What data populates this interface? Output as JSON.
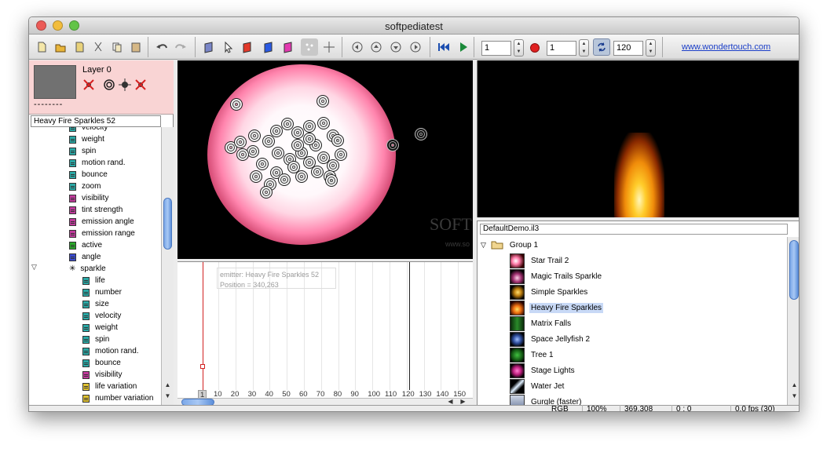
{
  "window": {
    "title": "softpediatest"
  },
  "toolbar": {
    "frame_value": "1",
    "record_value": "1",
    "fps_value": "120",
    "link_text": "www.wondertouch.com"
  },
  "layer": {
    "name": "Layer 0",
    "dashes": "--------"
  },
  "tree": {
    "header": "Heavy Fire Sparkles 52",
    "items": [
      {
        "label": "velocity",
        "color": "#2aa9a6"
      },
      {
        "label": "weight",
        "color": "#2aa9a6"
      },
      {
        "label": "spin",
        "color": "#2aa9a6"
      },
      {
        "label": "motion rand.",
        "color": "#2aa9a6"
      },
      {
        "label": "bounce",
        "color": "#2aa9a6"
      },
      {
        "label": "zoom",
        "color": "#2aa9a6"
      },
      {
        "label": "visibility",
        "color": "#c13a9c"
      },
      {
        "label": "tint strength",
        "color": "#c13a9c"
      },
      {
        "label": "emission angle",
        "color": "#c13a9c"
      },
      {
        "label": "emission range",
        "color": "#c13a9c"
      },
      {
        "label": "active",
        "color": "#2aaa2a"
      },
      {
        "label": "angle",
        "color": "#3a4acf"
      }
    ],
    "sparkle_label": "sparkle",
    "sparkle_items": [
      {
        "label": "life",
        "color": "#2aa9a6"
      },
      {
        "label": "number",
        "color": "#2aa9a6"
      },
      {
        "label": "size",
        "color": "#2aa9a6"
      },
      {
        "label": "velocity",
        "color": "#2aa9a6"
      },
      {
        "label": "weight",
        "color": "#2aa9a6"
      },
      {
        "label": "spin",
        "color": "#2aa9a6"
      },
      {
        "label": "motion rand.",
        "color": "#2aa9a6"
      },
      {
        "label": "bounce",
        "color": "#2aa9a6"
      },
      {
        "label": "visibility",
        "color": "#c13a9c"
      },
      {
        "label": "life variation",
        "color": "#e0c232"
      },
      {
        "label": "number variation",
        "color": "#e0c232"
      }
    ]
  },
  "canvas": {
    "watermark": "SOFT",
    "watermark_sub": "www.so"
  },
  "timeline": {
    "info_line1": "emitter: Heavy Fire Sparkles 52",
    "info_line2": "Position = 340,263",
    "current_frame": "1",
    "ticks": [
      "10",
      "20",
      "30",
      "40",
      "50",
      "60",
      "70",
      "80",
      "90",
      "100",
      "110",
      "120",
      "130",
      "140",
      "150"
    ]
  },
  "library": {
    "header": "DefaultDemo.il3",
    "group": "Group 1",
    "items": [
      {
        "label": "Star Trail 2",
        "selected": false
      },
      {
        "label": "Magic Trails Sparkle",
        "selected": false
      },
      {
        "label": "Simple Sparkles",
        "selected": false
      },
      {
        "label": "Heavy Fire Sparkles",
        "selected": true
      },
      {
        "label": "Matrix Falls",
        "selected": false
      },
      {
        "label": "Space Jellyfish 2",
        "selected": false
      },
      {
        "label": "Tree 1",
        "selected": false
      },
      {
        "label": "Stage Lights",
        "selected": false
      },
      {
        "label": "Water Jet",
        "selected": false
      },
      {
        "label": "Gurgle (faster)",
        "selected": false
      }
    ]
  },
  "status": {
    "mode": "RGB",
    "zoom": "100%",
    "coords": "369,308",
    "time": "0 : 0",
    "fps": "0.0 fps (30)"
  },
  "colors": {
    "close": "#ec5b57",
    "minimize": "#f2bd3c",
    "maximize": "#62c447",
    "record": "#e02020",
    "link": "#1a3ec8",
    "layer_bg": "#f9d4d4",
    "selection": "#c8d9f6"
  }
}
